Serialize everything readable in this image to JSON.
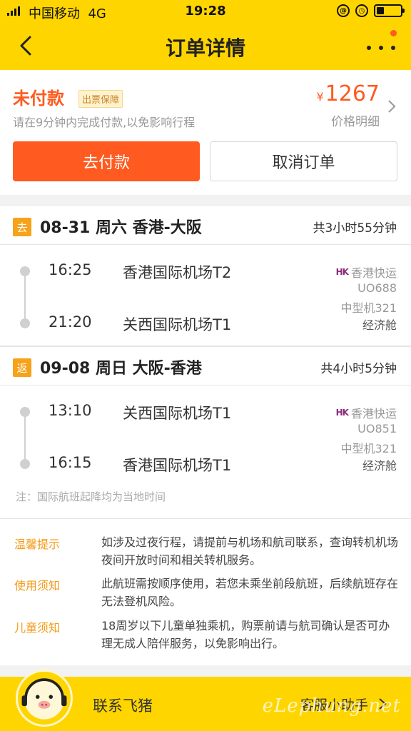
{
  "status_bar": {
    "carrier": "中国移动",
    "network": "4G",
    "time": "19:28",
    "battery_level": 0.3
  },
  "nav": {
    "title": "订单详情"
  },
  "payment": {
    "status": "未付款",
    "guarantee_badge": "出票保障",
    "hint": "请在9分钟内完成付款,以免影响行程",
    "currency_symbol": "¥",
    "price": "1267",
    "price_detail": "价格明细",
    "pay_button": "去付款",
    "cancel_button": "取消订单"
  },
  "segments": [
    {
      "tag": "去",
      "title": "08-31 周六 香港-大阪",
      "duration": "共3小时55分钟",
      "depart_time": "16:25",
      "depart_airport": "香港国际机场T2",
      "arrive_time": "21:20",
      "arrive_airport": "关西国际机场T1",
      "airline_logo": "HK",
      "airline": "香港快运",
      "flight_no": "UO688",
      "aircraft": "中型机321",
      "cabin": "经济舱"
    },
    {
      "tag": "返",
      "title": "09-08 周日 大阪-香港",
      "duration": "共4小时5分钟",
      "depart_time": "13:10",
      "depart_airport": "关西国际机场T1",
      "arrive_time": "16:15",
      "arrive_airport": "香港国际机场T1",
      "airline_logo": "HK",
      "airline": "香港快运",
      "flight_no": "UO851",
      "aircraft": "中型机321",
      "cabin": "经济舱"
    }
  ],
  "note": "注：国际航班起降均为当地时间",
  "tips": [
    {
      "label": "温馨提示",
      "text": "如涉及过夜行程，请提前与机场和航司联系，查询转机机场夜间开放时间和相关转机服务。"
    },
    {
      "label": "使用须知",
      "text": "此航班需按顺序使用，若您未乘坐前段航班，后续航班存在无法登机风险。"
    },
    {
      "label": "儿童须知",
      "text": "18周岁以下儿童单独乘机，购票前请与航司确认是否可办理无成人陪伴服务，以免影响出行。"
    }
  ],
  "bottom": {
    "contact": "联系飞猪",
    "assistant": "客服小助手",
    "watermark": "eLephung.net"
  },
  "colors": {
    "brand_yellow": "#ffd500",
    "accent_orange": "#ff5a1f",
    "tag_orange": "#f7a21b"
  }
}
